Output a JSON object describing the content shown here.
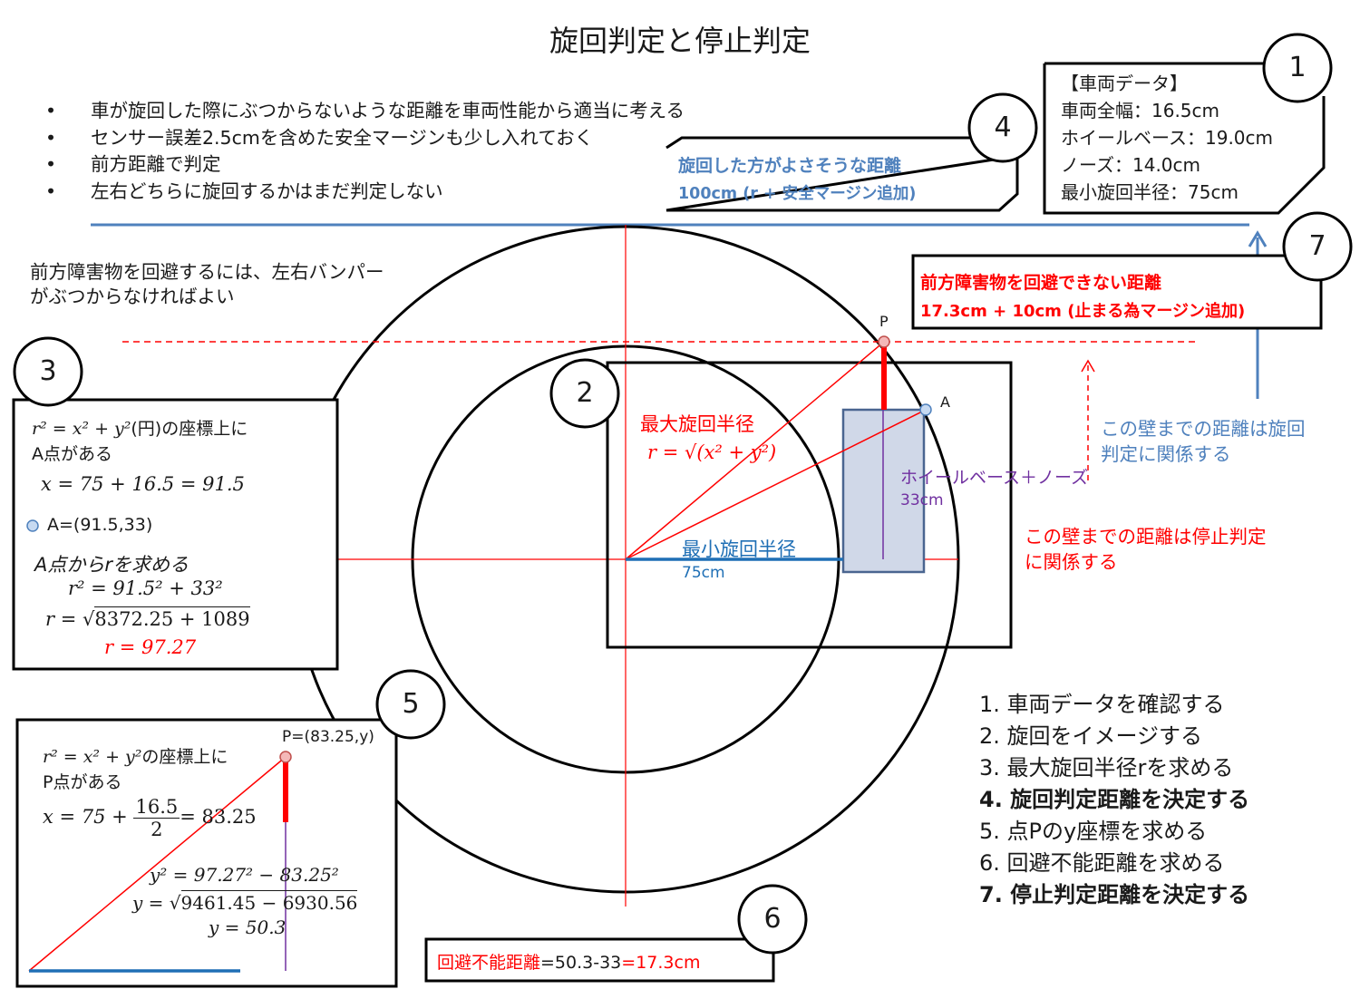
{
  "title": "旋回判定と停止判定",
  "bullets": [
    "車が旋回した際にぶつからないような距離を車両性能から適当に考える",
    "センサー誤差2.5cmを含めた安全マージンも少し入れておく",
    "前方距離で判定",
    "左右どちらに旋回するかはまだ判定しない"
  ],
  "bullet_mark": "•",
  "badges": [
    "1",
    "2",
    "3",
    "4",
    "5",
    "6",
    "7"
  ],
  "vehicle_data": {
    "heading": "【車両データ】",
    "rows": [
      "車両全幅：16.5cm",
      "ホイールベース：19.0cm",
      "ノーズ：14.0cm",
      "最小旋回半径：75cm"
    ]
  },
  "turn_note": {
    "line1": "旋回した方がよさそうな距離",
    "line2": "100cm (r + 安全マージン追加)"
  },
  "stop_note": {
    "line1": "前方障害物を回避できない距離",
    "line2": "17.3cm + 10cm (止まる為マージン追加)"
  },
  "bumper_note": "前方障害物を回避するには、左右バンパー\nがぶつからなければよい",
  "diagram": {
    "label_p": "P",
    "label_a": "A",
    "max_radius_label": "最大旋回半径",
    "max_radius_formula": "r = √(x² + y²)",
    "min_radius_label": "最小旋回半径",
    "min_radius_value": "75cm",
    "wheelbase_label": "ホイールベース＋ノーズ",
    "wheelbase_value": "33cm",
    "wall_turn_note": "この壁までの距離は旋回\n判定に関係する",
    "wall_stop_note": "この壁までの距離は停止判定\nに関係する"
  },
  "box3": {
    "line1_tail": "(円)の座標上に",
    "line2": "A点がある",
    "eq_x": "x = 75 + 16.5 = 91.5",
    "point_a": "A=(91.5,33)",
    "find_r": "A点からrを求める",
    "eq_r2": "r² = 91.5² + 33²",
    "eq_r_sqrt": "8372.25 + 1089",
    "eq_r_result": "r = 97.27"
  },
  "box5": {
    "line1_tail": "の座標上に",
    "line2": "P点がある",
    "point_p": "P=(83.25,y)",
    "frac_num": "16.5",
    "frac_den": "2",
    "eq_x_result": "= 83.25",
    "eq_y2": "y² = 97.27² − 83.25²",
    "eq_y_sqrt": "9461.45 − 6930.56",
    "eq_y_result": "y = 50.3"
  },
  "box6": {
    "label": "回避不能距離",
    "formula": "=50.3-33",
    "result": "=17.3cm"
  },
  "steps": [
    {
      "text": "1. 車両データを確認する",
      "bold": false
    },
    {
      "text": "2. 旋回をイメージする",
      "bold": false
    },
    {
      "text": "3. 最大旋回半径rを求める",
      "bold": false
    },
    {
      "text": "4. 旋回判定距離を決定する",
      "bold": true
    },
    {
      "text": "5. 点Pのy座標を求める",
      "bold": false
    },
    {
      "text": "6. 回避不能距離を求める",
      "bold": false
    },
    {
      "text": "7. 停止判定距離を決定する",
      "bold": true
    }
  ],
  "colors": {
    "red": "#ff0000",
    "blue": "#4f81bd",
    "line_blue": "#1f6fb5",
    "purple": "#7030a0",
    "car_fill": "#d0d8e8",
    "car_stroke": "#4a6590"
  }
}
